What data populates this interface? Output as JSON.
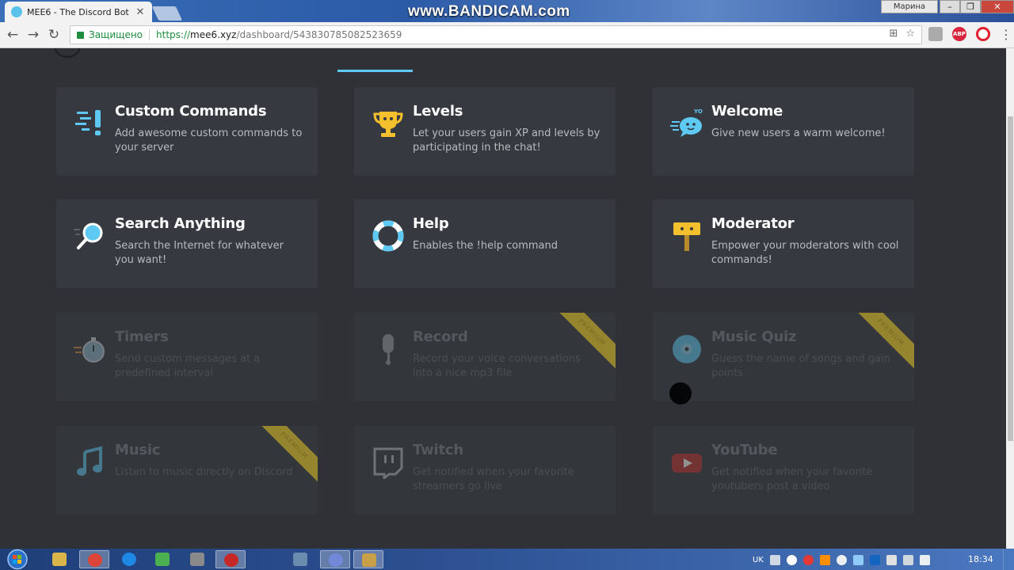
{
  "browser": {
    "tab_title": "MEE6 - The Discord Bot",
    "tab_close": "✕",
    "watermark": "www.BANDICAM.com",
    "user_button": "Марина",
    "window_min": "–",
    "window_max": "❐",
    "window_close": "✕",
    "back": "←",
    "forward": "→",
    "reload": "↻",
    "secure_label": "Защищено",
    "url_scheme": "https://",
    "url_host": "mee6.xyz",
    "url_path": "/dashboard/543830785082523659",
    "translate_icon": "⊞",
    "star_icon": "☆",
    "abp_label": "ABP",
    "menu_icon": "⋮"
  },
  "plugins": [
    {
      "title": "Custom Commands",
      "description": "Add awesome custom commands to your server",
      "enabled": true,
      "premium": false,
      "icon": "exclamation-list-icon"
    },
    {
      "title": "Levels",
      "description": "Let your users gain XP and levels by participating in the chat!",
      "enabled": true,
      "premium": false,
      "icon": "trophy-icon"
    },
    {
      "title": "Welcome",
      "description": "Give new users a warm welcome!",
      "enabled": true,
      "premium": false,
      "icon": "speech-bubble-icon",
      "icon_badge": "YO"
    },
    {
      "title": "Search Anything",
      "description": "Search the Internet for whatever you want!",
      "enabled": true,
      "premium": false,
      "icon": "magnifier-icon"
    },
    {
      "title": "Help",
      "description": "Enables the !help command",
      "enabled": true,
      "premium": false,
      "icon": "lifebuoy-icon"
    },
    {
      "title": "Moderator",
      "description": "Empower your moderators with cool commands!",
      "enabled": true,
      "premium": false,
      "icon": "hammer-icon"
    },
    {
      "title": "Timers",
      "description": "Send custom messages at a predefined interval",
      "enabled": false,
      "premium": false,
      "icon": "stopwatch-icon"
    },
    {
      "title": "Record",
      "description": "Record your voice conversations into a nice mp3 file",
      "enabled": false,
      "premium": true,
      "icon": "microphone-icon"
    },
    {
      "title": "Music Quiz",
      "description": "Guess the name of songs and gain points",
      "enabled": false,
      "premium": true,
      "icon": "disc-icon"
    },
    {
      "title": "Music",
      "description": "Listen to music directly on Discord",
      "enabled": false,
      "premium": true,
      "icon": "music-note-icon"
    },
    {
      "title": "Twitch",
      "description": "Get notified when your favorite streamers go live",
      "enabled": false,
      "premium": false,
      "icon": "twitch-icon"
    },
    {
      "title": "YouTube",
      "description": "Get notified when your favorite youtubers post a video",
      "enabled": false,
      "premium": false,
      "icon": "youtube-icon"
    }
  ],
  "premium_label": "PREMIUM",
  "taskbar": {
    "language": "UK",
    "clock": "18:34"
  },
  "colors": {
    "accent": "#5ec9f3",
    "page_bg": "#2f3136",
    "card_bg": "#36393f",
    "premium_ribbon": "#b8a02c",
    "trophy": "#f5c02e",
    "youtube_red": "#c4302b"
  }
}
